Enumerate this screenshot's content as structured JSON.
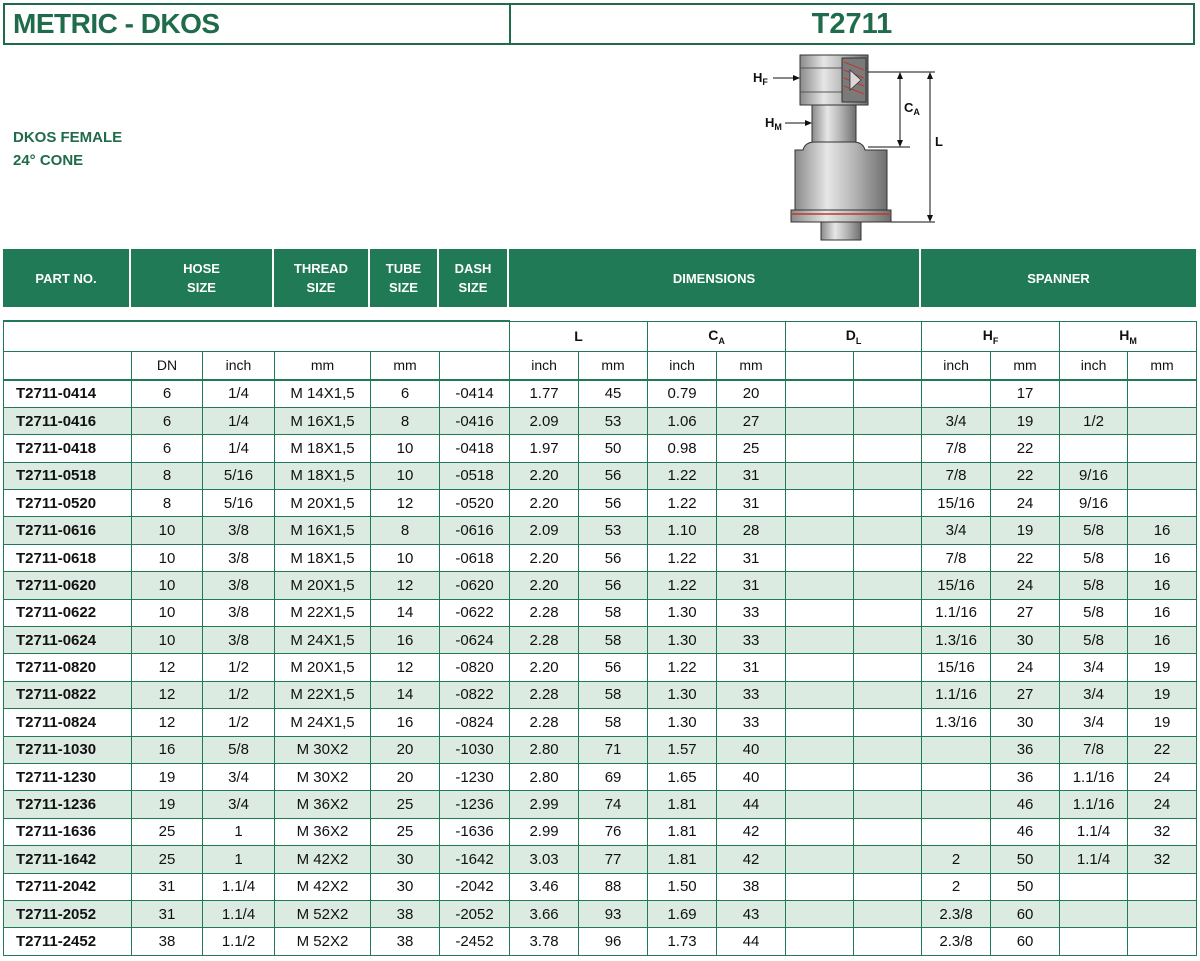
{
  "title": {
    "left": "METRIC - DKOS",
    "right": "T2711"
  },
  "subtitle": {
    "line1": "DKOS FEMALE",
    "line2": "24° CONE"
  },
  "diagram": {
    "hf": "H",
    "hf_sub": "F",
    "hm": "H",
    "hm_sub": "M",
    "ca": "C",
    "ca_sub": "A",
    "l": "L"
  },
  "header": {
    "part_no": "PART NO.",
    "hose_size": [
      "HOSE",
      "SIZE"
    ],
    "thread_size": [
      "THREAD",
      "SIZE"
    ],
    "tube_size": [
      "TUBE",
      "SIZE"
    ],
    "dash_size": [
      "DASH",
      "SIZE"
    ],
    "dimensions": "DIMENSIONS",
    "spanner": "SPANNER"
  },
  "subheader": {
    "L": "L",
    "CA": "C",
    "CA_sub": "A",
    "DL": "D",
    "DL_sub": "L",
    "HF": "H",
    "HF_sub": "F",
    "HM": "H",
    "HM_sub": "M"
  },
  "units": [
    "",
    "DN",
    "inch",
    "mm",
    "mm",
    "",
    "inch",
    "mm",
    "inch",
    "mm",
    "",
    "",
    "inch",
    "mm",
    "inch",
    "mm"
  ],
  "rows": [
    [
      "T2711-0414",
      "6",
      "1/4",
      "M 14X1,5",
      "6",
      "-0414",
      "1.77",
      "45",
      "0.79",
      "20",
      "",
      "",
      "",
      "17",
      "",
      ""
    ],
    [
      "T2711-0416",
      "6",
      "1/4",
      "M 16X1,5",
      "8",
      "-0416",
      "2.09",
      "53",
      "1.06",
      "27",
      "",
      "",
      "3/4",
      "19",
      "1/2",
      ""
    ],
    [
      "T2711-0418",
      "6",
      "1/4",
      "M 18X1,5",
      "10",
      "-0418",
      "1.97",
      "50",
      "0.98",
      "25",
      "",
      "",
      "7/8",
      "22",
      "",
      ""
    ],
    [
      "T2711-0518",
      "8",
      "5/16",
      "M 18X1,5",
      "10",
      "-0518",
      "2.20",
      "56",
      "1.22",
      "31",
      "",
      "",
      "7/8",
      "22",
      "9/16",
      ""
    ],
    [
      "T2711-0520",
      "8",
      "5/16",
      "M 20X1,5",
      "12",
      "-0520",
      "2.20",
      "56",
      "1.22",
      "31",
      "",
      "",
      "15/16",
      "24",
      "9/16",
      ""
    ],
    [
      "T2711-0616",
      "10",
      "3/8",
      "M 16X1,5",
      "8",
      "-0616",
      "2.09",
      "53",
      "1.10",
      "28",
      "",
      "",
      "3/4",
      "19",
      "5/8",
      "16"
    ],
    [
      "T2711-0618",
      "10",
      "3/8",
      "M 18X1,5",
      "10",
      "-0618",
      "2.20",
      "56",
      "1.22",
      "31",
      "",
      "",
      "7/8",
      "22",
      "5/8",
      "16"
    ],
    [
      "T2711-0620",
      "10",
      "3/8",
      "M 20X1,5",
      "12",
      "-0620",
      "2.20",
      "56",
      "1.22",
      "31",
      "",
      "",
      "15/16",
      "24",
      "5/8",
      "16"
    ],
    [
      "T2711-0622",
      "10",
      "3/8",
      "M 22X1,5",
      "14",
      "-0622",
      "2.28",
      "58",
      "1.30",
      "33",
      "",
      "",
      "1.1/16",
      "27",
      "5/8",
      "16"
    ],
    [
      "T2711-0624",
      "10",
      "3/8",
      "M 24X1,5",
      "16",
      "-0624",
      "2.28",
      "58",
      "1.30",
      "33",
      "",
      "",
      "1.3/16",
      "30",
      "5/8",
      "16"
    ],
    [
      "T2711-0820",
      "12",
      "1/2",
      "M 20X1,5",
      "12",
      "-0820",
      "2.20",
      "56",
      "1.22",
      "31",
      "",
      "",
      "15/16",
      "24",
      "3/4",
      "19"
    ],
    [
      "T2711-0822",
      "12",
      "1/2",
      "M 22X1,5",
      "14",
      "-0822",
      "2.28",
      "58",
      "1.30",
      "33",
      "",
      "",
      "1.1/16",
      "27",
      "3/4",
      "19"
    ],
    [
      "T2711-0824",
      "12",
      "1/2",
      "M 24X1,5",
      "16",
      "-0824",
      "2.28",
      "58",
      "1.30",
      "33",
      "",
      "",
      "1.3/16",
      "30",
      "3/4",
      "19"
    ],
    [
      "T2711-1030",
      "16",
      "5/8",
      "M 30X2",
      "20",
      "-1030",
      "2.80",
      "71",
      "1.57",
      "40",
      "",
      "",
      "",
      "36",
      "7/8",
      "22"
    ],
    [
      "T2711-1230",
      "19",
      "3/4",
      "M 30X2",
      "20",
      "-1230",
      "2.80",
      "69",
      "1.65",
      "40",
      "",
      "",
      "",
      "36",
      "1.1/16",
      "24"
    ],
    [
      "T2711-1236",
      "19",
      "3/4",
      "M 36X2",
      "25",
      "-1236",
      "2.99",
      "74",
      "1.81",
      "44",
      "",
      "",
      "",
      "46",
      "1.1/16",
      "24"
    ],
    [
      "T2711-1636",
      "25",
      "1",
      "M 36X2",
      "25",
      "-1636",
      "2.99",
      "76",
      "1.81",
      "42",
      "",
      "",
      "",
      "46",
      "1.1/4",
      "32"
    ],
    [
      "T2711-1642",
      "25",
      "1",
      "M 42X2",
      "30",
      "-1642",
      "3.03",
      "77",
      "1.81",
      "42",
      "",
      "",
      "2",
      "50",
      "1.1/4",
      "32"
    ],
    [
      "T2711-2042",
      "31",
      "1.1/4",
      "M 42X2",
      "30",
      "-2042",
      "3.46",
      "88",
      "1.50",
      "38",
      "",
      "",
      "2",
      "50",
      "",
      ""
    ],
    [
      "T2711-2052",
      "31",
      "1.1/4",
      "M 52X2",
      "38",
      "-2052",
      "3.66",
      "93",
      "1.69",
      "43",
      "",
      "",
      "2.3/8",
      "60",
      "",
      ""
    ],
    [
      "T2711-2452",
      "38",
      "1.1/2",
      "M 52X2",
      "38",
      "-2452",
      "3.78",
      "96",
      "1.73",
      "44",
      "",
      "",
      "2.3/8",
      "60",
      "",
      ""
    ]
  ],
  "colors": {
    "brand_green": "#1f6b4a",
    "band_green": "#1f7a55",
    "alt_row": "#dcebe2"
  }
}
